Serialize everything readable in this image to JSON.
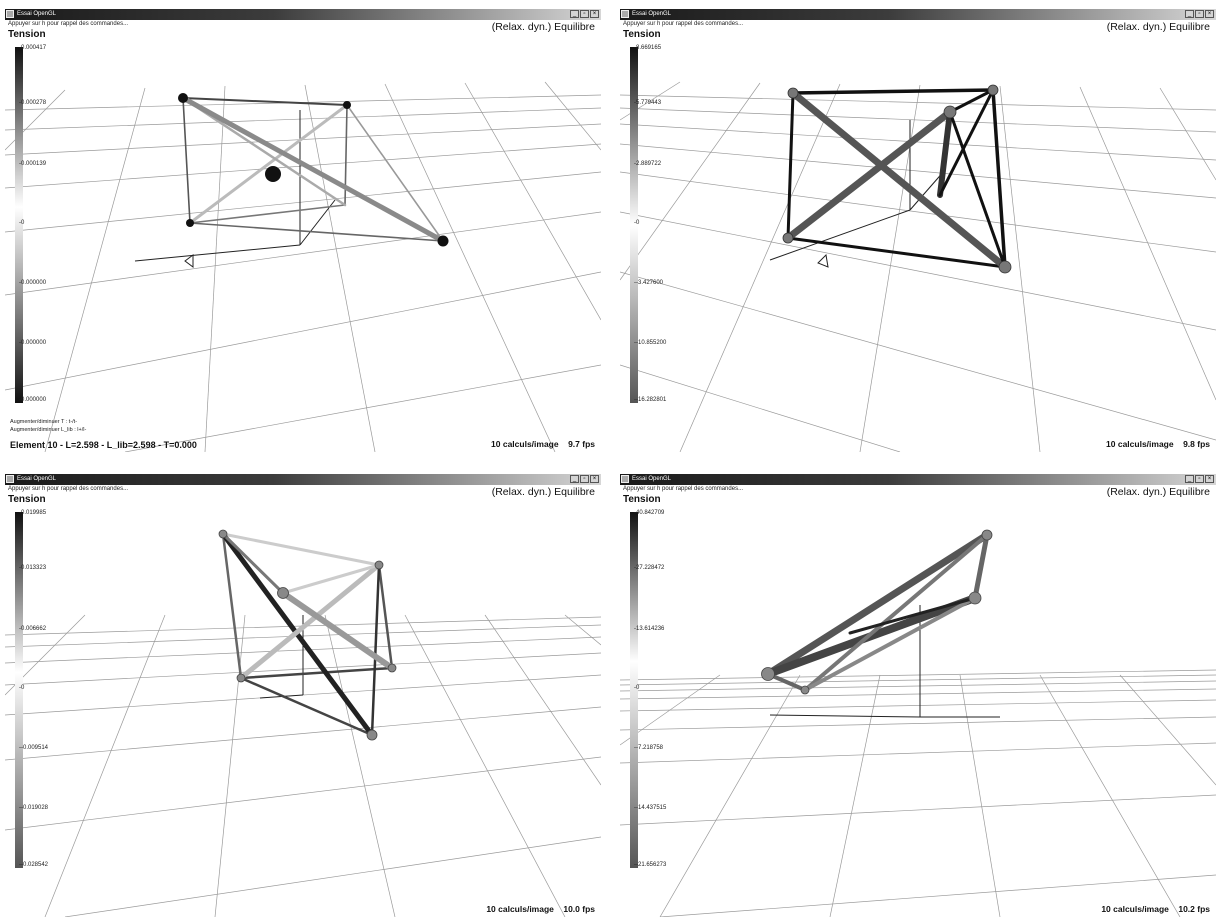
{
  "windows": [
    {
      "title": "Essai OpenGL",
      "hint": "Appuyer sur h pour rappel des commandes...",
      "mode": "(Relax. dyn.) Equilibre",
      "legend_title": "Tension",
      "ticks": [
        "0.000417",
        "0.000278",
        "0.000139",
        "0",
        "0.000000",
        "0.000000",
        "0.000000"
      ],
      "help_lines": [
        "Augmenter/diminuer T : t-/t-",
        "Augmenter/diminuer L_lib : l+/l-"
      ],
      "element_info": "Element 10 - L=2.598 - L_lib=2.598 - T=0.000",
      "calc": "10 calculs/image",
      "fps": "9.7 fps"
    },
    {
      "title": "Essai OpenGL",
      "hint": "Appuyer sur h pour rappel des commandes...",
      "mode": "(Relax. dyn.) Equilibre",
      "legend_title": "Tension",
      "ticks": [
        "8.669165",
        "5.779443",
        "2.889722",
        "0",
        "-3.427600",
        "-10.855200",
        "-16.282801"
      ],
      "help_lines": [],
      "element_info": "",
      "calc": "10 calculs/image",
      "fps": "9.8 fps"
    },
    {
      "title": "Essai OpenGL",
      "hint": "Appuyer sur h pour rappel des commandes...",
      "mode": "(Relax. dyn.) Equilibre",
      "legend_title": "Tension",
      "ticks": [
        "0.019985",
        "0.013323",
        "0.006662",
        "0",
        "-0.009514",
        "-0.019028",
        "-0.028542"
      ],
      "help_lines": [],
      "element_info": "",
      "calc": "10 calculs/image",
      "fps": "10.0 fps"
    },
    {
      "title": "Essai OpenGL",
      "hint": "Appuyer sur h pour rappel des commandes...",
      "mode": "(Relax. dyn.) Equilibre",
      "legend_title": "Tension",
      "ticks": [
        "40.842709",
        "27.228472",
        "13.614236",
        "0",
        "-7.218758",
        "-14.437515",
        "-21.656273"
      ],
      "help_lines": [],
      "element_info": "",
      "calc": "10 calculs/image",
      "fps": "10.2 fps"
    }
  ],
  "window_buttons": [
    "_",
    "▫",
    "×"
  ]
}
